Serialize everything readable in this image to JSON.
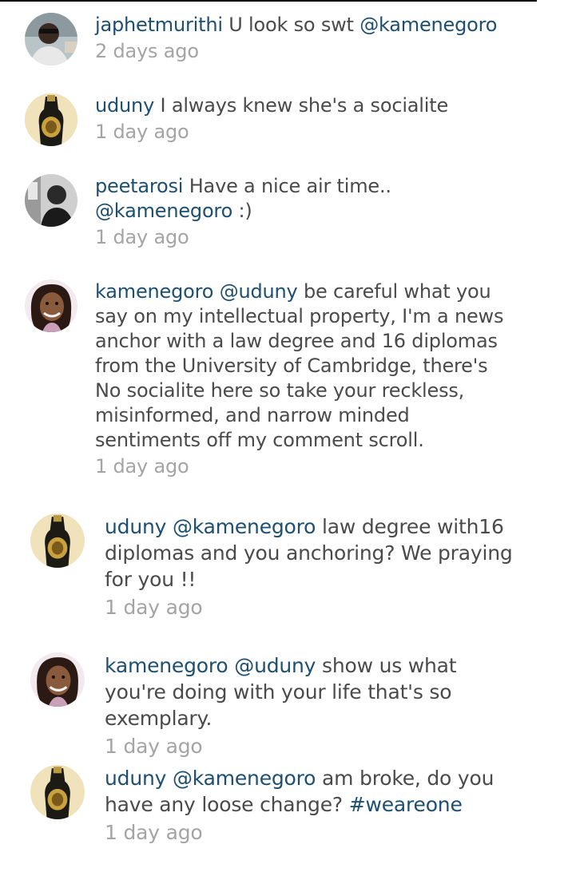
{
  "colors": {
    "link": "#1d4f73",
    "text": "#4a4a4a",
    "timestamp": "#a4a4a4"
  },
  "comments": [
    {
      "username": "japhetmurithi",
      "segments": [
        {
          "type": "text",
          "value": " U look so swt "
        },
        {
          "type": "mention",
          "value": "@kamenegoro"
        }
      ],
      "time": "2 days ago",
      "avatar": "man-photo-avatar"
    },
    {
      "username": "uduny",
      "segments": [
        {
          "type": "text",
          "value": " I always knew she's a socialite"
        }
      ],
      "time": "1 day ago",
      "avatar": "bottle-avatar"
    },
    {
      "username": "peetarosi",
      "segments": [
        {
          "type": "text",
          "value": " Have a nice air time.."
        },
        {
          "type": "mention",
          "value": "@kamenegoro"
        },
        {
          "type": "text",
          "value": " :)"
        }
      ],
      "time": "1 day ago",
      "avatar": "man-bw-avatar"
    },
    {
      "username": "kamenegoro",
      "segments": [
        {
          "type": "text",
          "value": " "
        },
        {
          "type": "mention",
          "value": "@uduny"
        },
        {
          "type": "text",
          "value": " be careful what you say on my intellectual property,  I'm a news anchor with a law degree and 16 diplomas from the University of Cambridge, there's No socialite here so take your reckless, misinformed, and narrow minded sentiments off my comment scroll."
        }
      ],
      "time": "1 day ago",
      "avatar": "woman-avatar"
    },
    {
      "username": "uduny",
      "segments": [
        {
          "type": "text",
          "value": " "
        },
        {
          "type": "mention",
          "value": "@kamenegoro"
        },
        {
          "type": "text",
          "value": " law degree with16 diplomas and you anchoring? We praying for you !!"
        }
      ],
      "time": "1 day ago",
      "avatar": "bottle-avatar"
    },
    {
      "username": "kamenegoro",
      "segments": [
        {
          "type": "text",
          "value": " "
        },
        {
          "type": "mention",
          "value": "@uduny"
        },
        {
          "type": "text",
          "value": " show us what you're doing with your life that's so exemplary."
        }
      ],
      "time": "1 day ago",
      "avatar": "woman-avatar"
    },
    {
      "username": "uduny",
      "segments": [
        {
          "type": "text",
          "value": " "
        },
        {
          "type": "mention",
          "value": "@kamenegoro"
        },
        {
          "type": "text",
          "value": " am broke, do you have any loose change? "
        },
        {
          "type": "hashtag",
          "value": "#weareone"
        }
      ],
      "time": "1 day ago",
      "avatar": "bottle-avatar"
    }
  ]
}
